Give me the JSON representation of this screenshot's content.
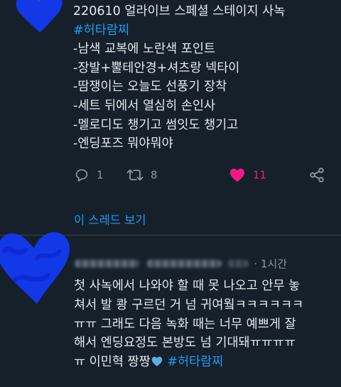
{
  "tweet1": {
    "lines": [
      "220610 얼라이브 스페셜 스테이지 사녹",
      "#허타람찌",
      "-남색 교복에 노란색 포인트",
      "-장발+뿔테안경+셔츠랑 넥타이",
      "-땀쟁이는 오늘도 선풍기 장착",
      "-세트 뒤에서 열심히 손인사",
      "-멜로디도 챙기고 썸잇도 챙기고",
      "-엔딩포즈 뭐야뭐야"
    ],
    "reply_count": "1",
    "retweet_count": "8",
    "like_count": "11",
    "show_thread": "이 스레드 보기"
  },
  "tweet2": {
    "time": "· 1시간",
    "text_main": "첫 사녹에서 나와야 할 때 못 나오고 안무 놓\n쳐서 발 쾅 구르던 거 넘 귀여웤ㅋㅋㅋㅋㅋㅋ\nㅠㅠ 그래도 다음 녹화 때는 너무 예쁘게 잘\n해서 엔딩요정도 본방도 넘 기대돼ㅠㅠㅠㅠ\nㅠ 이민혁 짱짱",
    "hashtag": "#허타람찌",
    "heart_emoji": "blue-heart-emoji"
  },
  "colors": {
    "background": "#15202b",
    "text": "#e7e9ea",
    "muted": "#8b98a5",
    "accent": "#1d9bf0",
    "like": "#f91880",
    "scribble": "#1238e8"
  },
  "icons": [
    "reply-icon",
    "retweet-icon",
    "like-icon-filled",
    "share-icon"
  ]
}
